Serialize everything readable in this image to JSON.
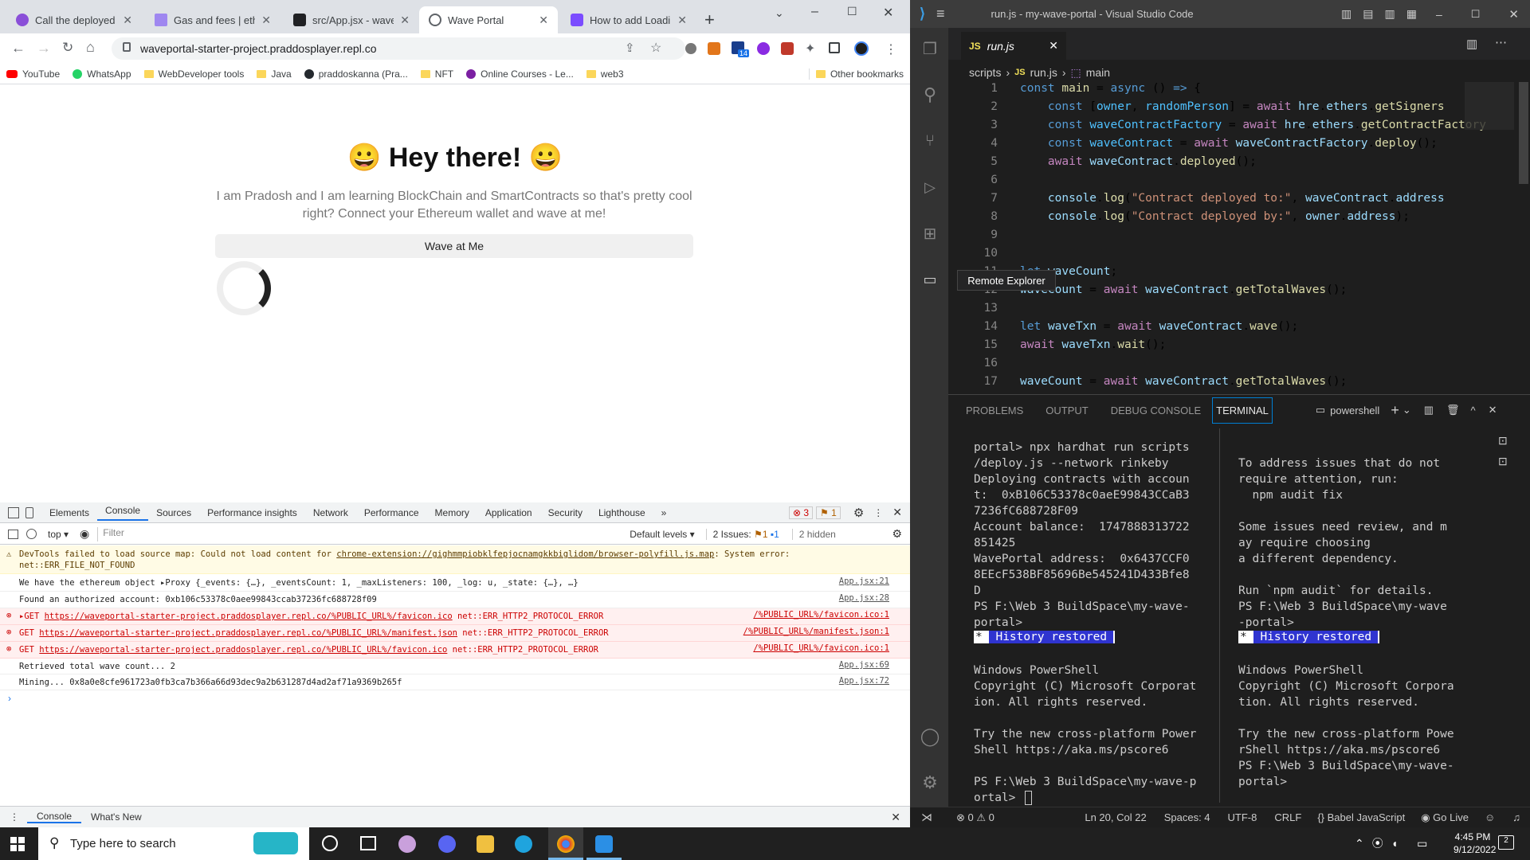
{
  "browser": {
    "tabs": [
      {
        "title": "Call the deployed sm",
        "fav_color": "#8a4fd8"
      },
      {
        "title": "Gas and fees | ethere",
        "fav_color": "#9f87f0"
      },
      {
        "title": "src/App.jsx - wavepo",
        "fav_color": "#202124"
      },
      {
        "title": "Wave Portal",
        "fav_color": "#5f6368"
      },
      {
        "title": "How to add Loading",
        "fav_color": "#7b4cff"
      }
    ],
    "url": "waveportal-starter-project.praddosplayer.repl.co",
    "extension_badge": "14",
    "bookmarks": [
      "YouTube",
      "WhatsApp",
      "WebDeveloper tools",
      "Java",
      "praddoskanna (Pra...",
      "NFT",
      "Online Courses - Le...",
      "web3"
    ],
    "other_bookmarks": "Other bookmarks"
  },
  "page": {
    "emoji": "😀",
    "heading": "Hey there!",
    "intro": "I am Pradosh and I am learning BlockChain and SmartContracts so that's pretty cool right? Connect your Ethereum wallet and wave at me!",
    "button": "Wave at Me"
  },
  "devtools": {
    "tabs": [
      "Elements",
      "Console",
      "Sources",
      "Performance insights",
      "Network",
      "Performance",
      "Memory",
      "Application",
      "Security",
      "Lighthouse"
    ],
    "more": "»",
    "error_count": "3",
    "warn_count": "1",
    "context": "top",
    "filter_placeholder": "Filter",
    "levels": "Default levels",
    "issues_label": "2 Issues:",
    "issues_warn": "1",
    "issues_info": "1",
    "hidden": "2 hidden",
    "rows": [
      {
        "type": "warn",
        "text": "DevTools failed to load source map: Could not load content for ",
        "link": "chrome-extension://gighmmpiobklfepjocnamgkkbiglidom/browser-polyfill.js.map",
        "text2": ": System error:",
        "line2": "net::ERR_FILE_NOT_FOUND",
        "src": ""
      },
      {
        "type": "log",
        "text": "We have the ethereum object ▸Proxy {_events: {…}, _eventsCount: 1, _maxListeners: 100, _log: u, _state: {…}, …}",
        "src": "App.jsx:21"
      },
      {
        "type": "log",
        "text": "Found an authorized account: 0xb106c53378c0aee99843ccab37236fc688728f09",
        "src": "App.jsx:28"
      },
      {
        "type": "err",
        "text": "▸GET ",
        "link": "https://waveportal-starter-project.praddosplayer.repl.co/%PUBLIC_URL%/favicon.ico",
        "text2": " net::ERR_HTTP2_PROTOCOL_ERROR",
        "src": "/%PUBLIC_URL%/favicon.ico:1"
      },
      {
        "type": "err",
        "text": "GET ",
        "link": "https://waveportal-starter-project.praddosplayer.repl.co/%PUBLIC_URL%/manifest.json",
        "text2": " net::ERR_HTTP2_PROTOCOL_ERROR",
        "src": "/%PUBLIC_URL%/manifest.json:1"
      },
      {
        "type": "err",
        "text": "GET ",
        "link": "https://waveportal-starter-project.praddosplayer.repl.co/%PUBLIC_URL%/favicon.ico",
        "text2": " net::ERR_HTTP2_PROTOCOL_ERROR",
        "src": "/%PUBLIC_URL%/favicon.ico:1"
      },
      {
        "type": "log",
        "text": "Retrieved total wave count... 2",
        "src": "App.jsx:69"
      },
      {
        "type": "log",
        "text": "Mining... 0x8a0e8cfe961723a0fb3ca7b366a66d93dec9a2b631287d4ad2af71a9369b265f",
        "src": "App.jsx:72"
      }
    ],
    "drawer_tabs": [
      "Console",
      "What's New"
    ]
  },
  "vscode": {
    "title": "run.js - my-wave-portal - Visual Studio Code",
    "tab": "run.js",
    "breadcrumb": [
      "scripts",
      "run.js",
      "main"
    ],
    "tooltip": "Remote Explorer",
    "panel_tabs": [
      "PROBLEMS",
      "OUTPUT",
      "DEBUG CONSOLE",
      "TERMINAL"
    ],
    "shell": "powershell",
    "terminal_left": "portal> npx hardhat run scripts\n/deploy.js --network rinkeby\nDeploying contracts with accoun\nt:  0xB106C53378c0aeE99843CCaB3\n7236fC688728F09\nAccount balance:  1747888313722\n851425\nWavePortal address:  0x6437CCF0\n8EEcF538BF85696Be545241D433Bfe8\nD\nPS F:\\Web 3 BuildSpace\\my-wave-\nportal>",
    "terminal_right": "To address issues that do not\nrequire attention, run:\n  npm audit fix\n\nSome issues need review, and m\nay require choosing\na different dependency.\n\nRun `npm audit` for details.\nPS F:\\Web 3 BuildSpace\\my-wave\n-portal>",
    "history": "History restored",
    "ps_left": "Windows PowerShell\nCopyright (C) Microsoft Corporat\nion. All rights reserved.\n\nTry the new cross-platform Power\nShell https://aka.ms/pscore6\n\nPS F:\\Web 3 BuildSpace\\my-wave-p\nortal> ",
    "ps_right": "Windows PowerShell\nCopyright (C) Microsoft Corpora\ntion. All rights reserved.\n\nTry the new cross-platform Powe\nrShell https://aka.ms/pscore6\nPS F:\\Web 3 BuildSpace\\my-wave-\nportal>",
    "status": {
      "errors": "0",
      "warnings": "0",
      "position": "Ln 20, Col 22",
      "spaces": "Spaces: 4",
      "encoding": "UTF-8",
      "eol": "CRLF",
      "language": "Babel JavaScript",
      "golive": "Go Live"
    }
  },
  "taskbar": {
    "search_placeholder": "Type here to search",
    "time": "4:45 PM",
    "date": "9/12/2022",
    "notif_count": "2"
  }
}
